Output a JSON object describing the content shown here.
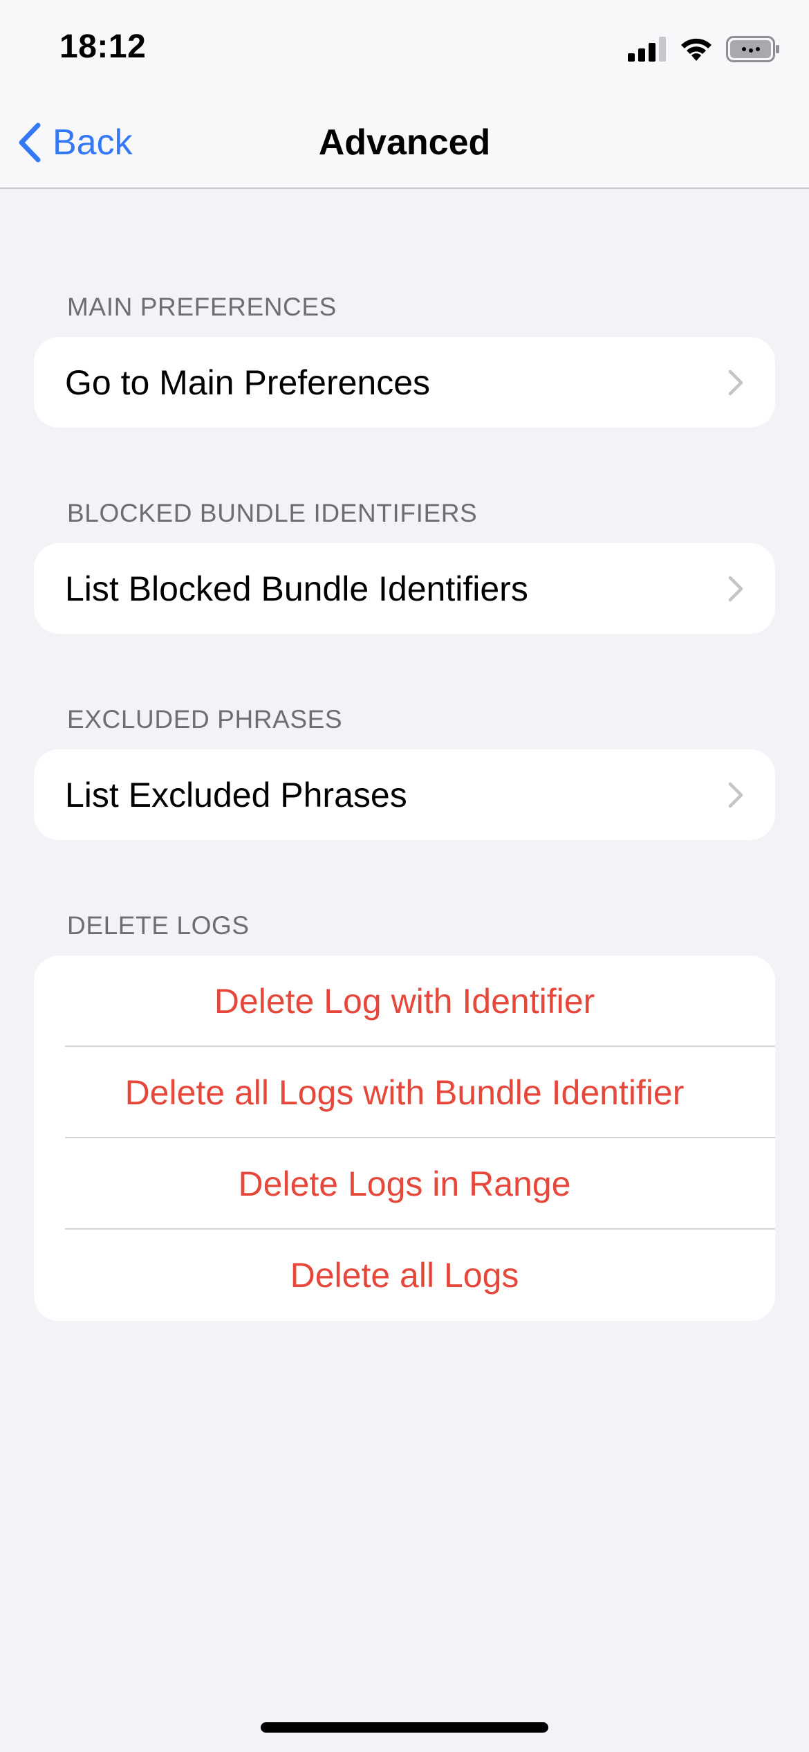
{
  "status_bar": {
    "time": "18:12",
    "icons": [
      "cellular-signal-icon",
      "wifi-icon",
      "battery-icon"
    ]
  },
  "nav_bar": {
    "back_label": "Back",
    "title": "Advanced"
  },
  "sections": [
    {
      "header": "MAIN PREFERENCES",
      "rows": [
        {
          "label": "Go to Main Preferences"
        }
      ]
    },
    {
      "header": "BLOCKED BUNDLE IDENTIFIERS",
      "rows": [
        {
          "label": "List Blocked Bundle Identifiers"
        }
      ]
    },
    {
      "header": "EXCLUDED PHRASES",
      "rows": [
        {
          "label": "List Excluded Phrases"
        }
      ]
    },
    {
      "header": "DELETE LOGS",
      "rows": [
        {
          "label": "Delete Log with Identifier"
        },
        {
          "label": "Delete all Logs with Bundle Identifier"
        },
        {
          "label": "Delete Logs in Range"
        },
        {
          "label": "Delete all Logs"
        }
      ]
    }
  ],
  "colors": {
    "accent": "#3478f6",
    "destructive": "#e5473b",
    "background": "#f2f2f7",
    "section_header": "#6d6d72"
  }
}
